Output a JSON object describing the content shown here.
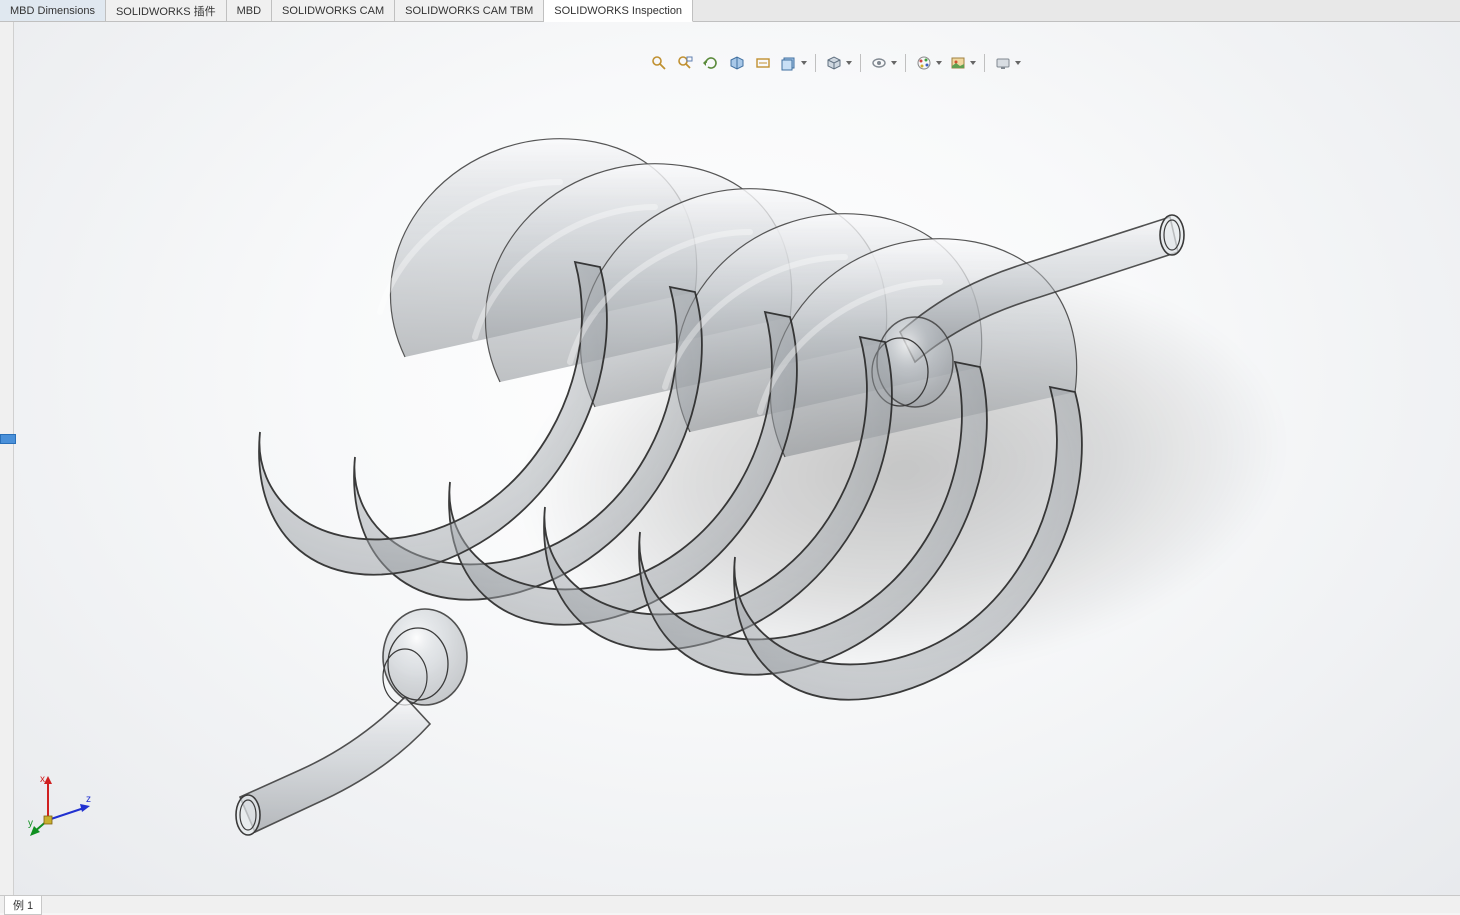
{
  "tabs": [
    {
      "label": "MBD Dimensions",
      "active": false
    },
    {
      "label": "SOLIDWORKS 插件",
      "active": false
    },
    {
      "label": "MBD",
      "active": false
    },
    {
      "label": "SOLIDWORKS CAM",
      "active": false
    },
    {
      "label": "SOLIDWORKS CAM TBM",
      "active": false
    },
    {
      "label": "SOLIDWORKS Inspection",
      "active": true
    }
  ],
  "hud_toolbar": {
    "icons": [
      {
        "name": "zoom-to-fit-icon",
        "dropdown": false
      },
      {
        "name": "zoom-area-icon",
        "dropdown": false
      },
      {
        "name": "previous-view-icon",
        "dropdown": false
      },
      {
        "name": "section-view-icon",
        "dropdown": false
      },
      {
        "name": "dynamic-annotation-icon",
        "dropdown": false
      },
      {
        "name": "view-orientation-icon",
        "dropdown": true
      },
      {
        "name": "separator"
      },
      {
        "name": "display-style-icon",
        "dropdown": true
      },
      {
        "name": "separator"
      },
      {
        "name": "hide-show-icon",
        "dropdown": true
      },
      {
        "name": "separator"
      },
      {
        "name": "edit-appearance-icon",
        "dropdown": true
      },
      {
        "name": "apply-scene-icon",
        "dropdown": true
      },
      {
        "name": "separator"
      },
      {
        "name": "view-settings-icon",
        "dropdown": true
      }
    ]
  },
  "triad": {
    "x_label": "x",
    "y_label": "y",
    "z_label": "z"
  },
  "status": {
    "config_label": "例 1"
  },
  "model": {
    "description": "Helical coil tube (spring) with straight inlet/outlet pipes, transparent gray material, ~6 turns",
    "material": "transparent-gray",
    "turns": 6
  }
}
